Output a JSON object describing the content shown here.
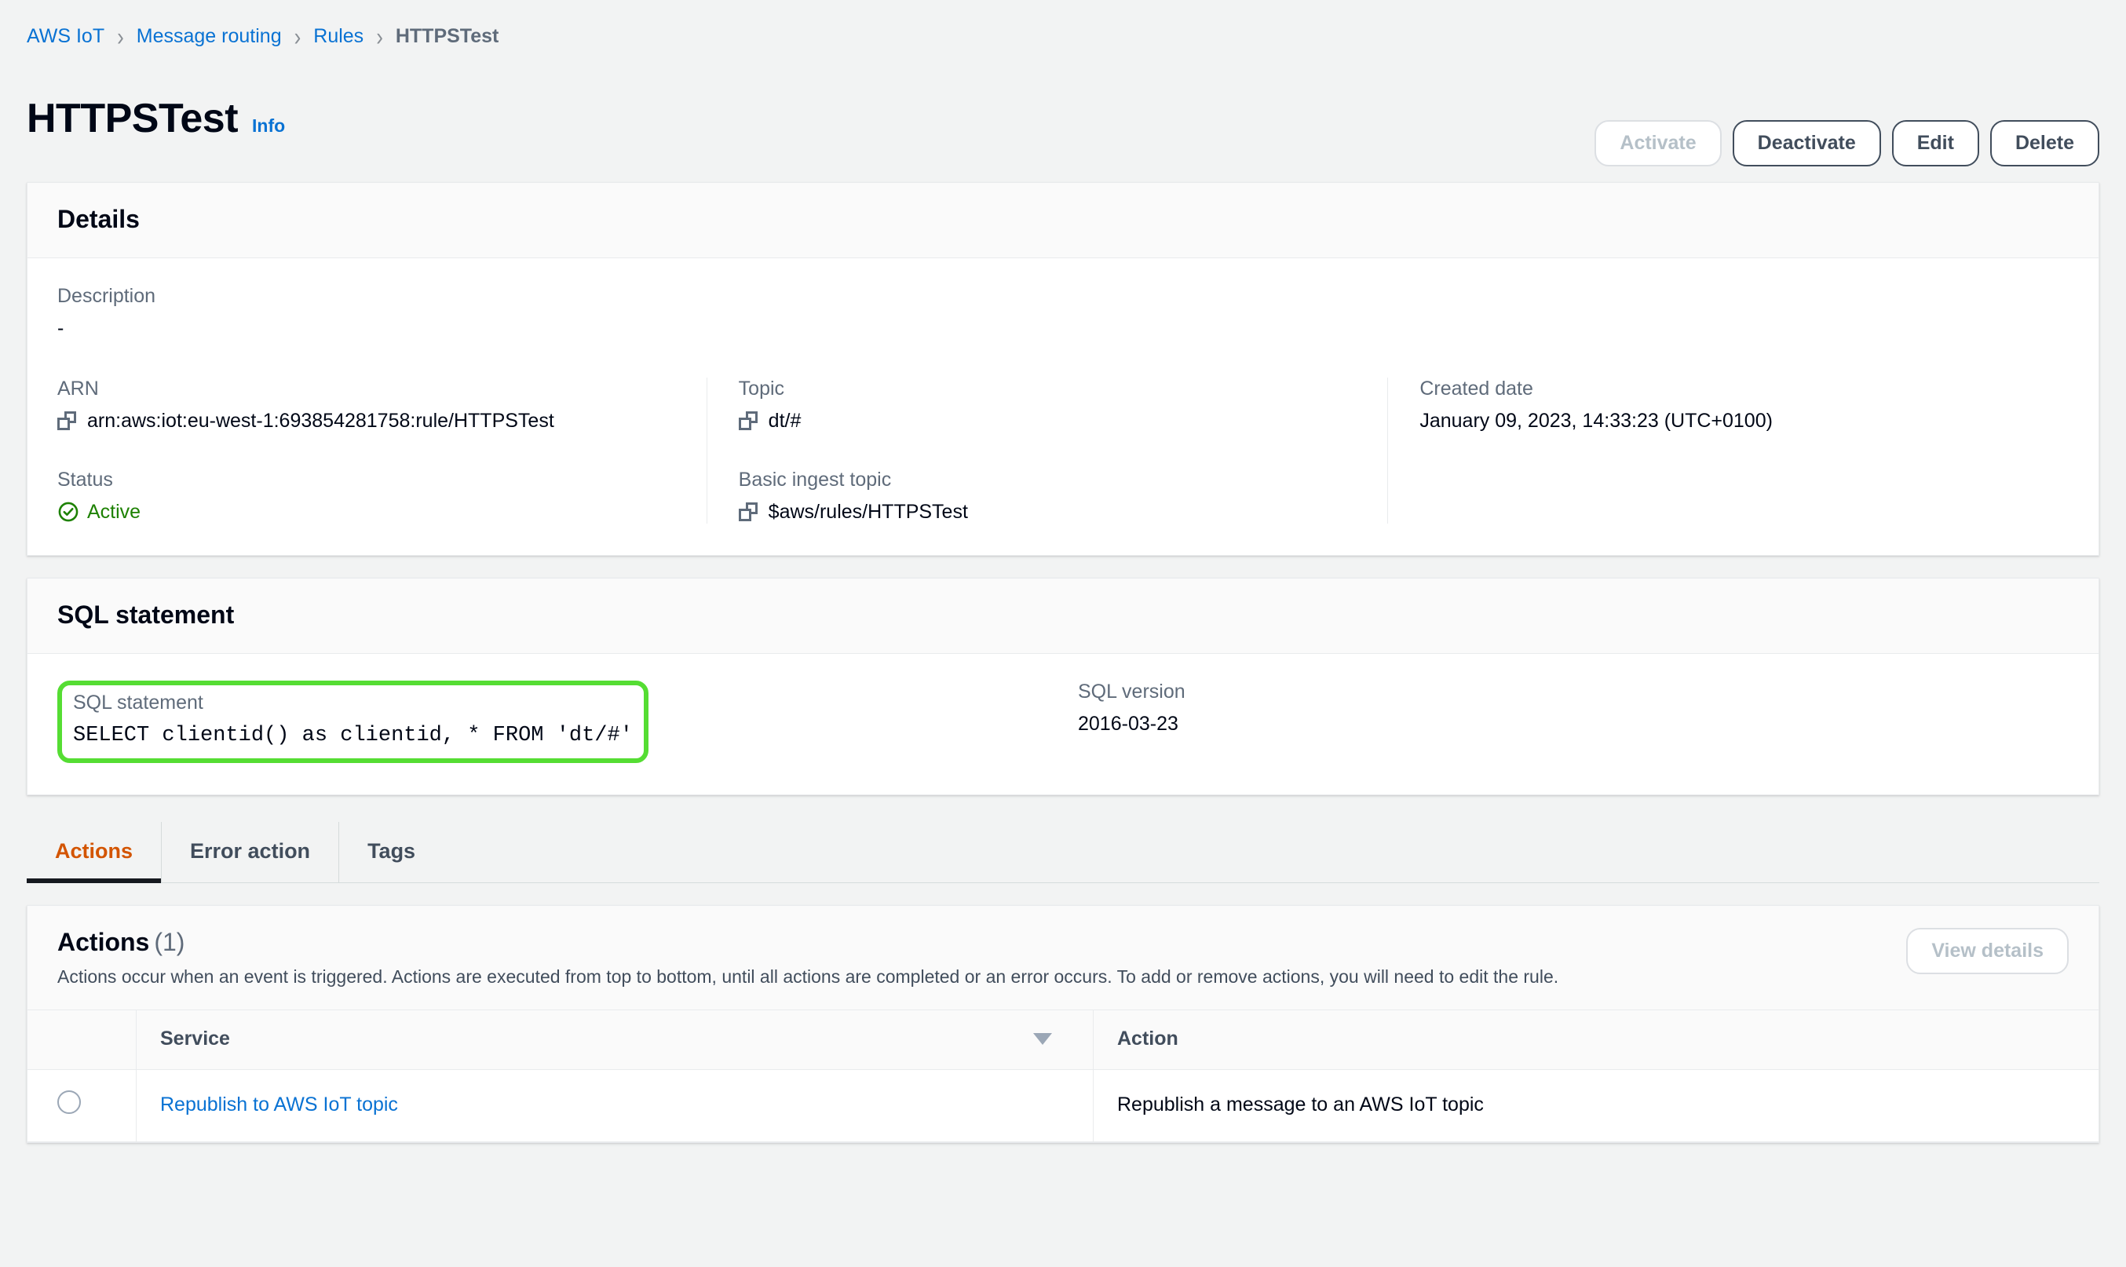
{
  "breadcrumb": {
    "items": [
      {
        "label": "AWS IoT",
        "current": false
      },
      {
        "label": "Message routing",
        "current": false
      },
      {
        "label": "Rules",
        "current": false
      },
      {
        "label": "HTTPSTest",
        "current": true
      }
    ],
    "separator": "›"
  },
  "header": {
    "title": "HTTPSTest",
    "info_label": "Info",
    "buttons": {
      "activate": "Activate",
      "deactivate": "Deactivate",
      "edit": "Edit",
      "delete": "Delete"
    }
  },
  "details": {
    "card_title": "Details",
    "description_label": "Description",
    "description_value": "-",
    "arn_label": "ARN",
    "arn_value": "arn:aws:iot:eu-west-1:693854281758:rule/HTTPSTest",
    "status_label": "Status",
    "status_value": "Active",
    "topic_label": "Topic",
    "topic_value": "dt/#",
    "basic_ingest_label": "Basic ingest topic",
    "basic_ingest_value": "$aws/rules/HTTPSTest",
    "created_label": "Created date",
    "created_value": "January 09, 2023, 14:33:23 (UTC+0100)"
  },
  "sql": {
    "card_title": "SQL statement",
    "statement_label": "SQL statement",
    "statement_value": "SELECT clientid() as clientid, * FROM 'dt/#'",
    "version_label": "SQL version",
    "version_value": "2016-03-23"
  },
  "tabs": [
    {
      "label": "Actions",
      "active": true
    },
    {
      "label": "Error action",
      "active": false
    },
    {
      "label": "Tags",
      "active": false
    }
  ],
  "actions": {
    "title": "Actions",
    "count": "(1)",
    "description": "Actions occur when an event is triggered. Actions are executed from top to bottom, until all actions are completed or an error occurs. To add or remove actions, you will need to edit the rule.",
    "view_details_label": "View details",
    "columns": {
      "service": "Service",
      "action": "Action"
    },
    "rows": [
      {
        "service": "Republish to AWS IoT topic",
        "action": "Republish a message to an AWS IoT topic"
      }
    ]
  },
  "colors": {
    "link": "#0972d3",
    "accent_tab": "#d35400",
    "status_green": "#1d8102",
    "highlight_green": "#55dd33",
    "page_bg": "#f2f3f3"
  },
  "icons": {
    "copy": "copy-icon",
    "status_check": "check-circle-icon",
    "sort": "sort-descending-icon"
  }
}
